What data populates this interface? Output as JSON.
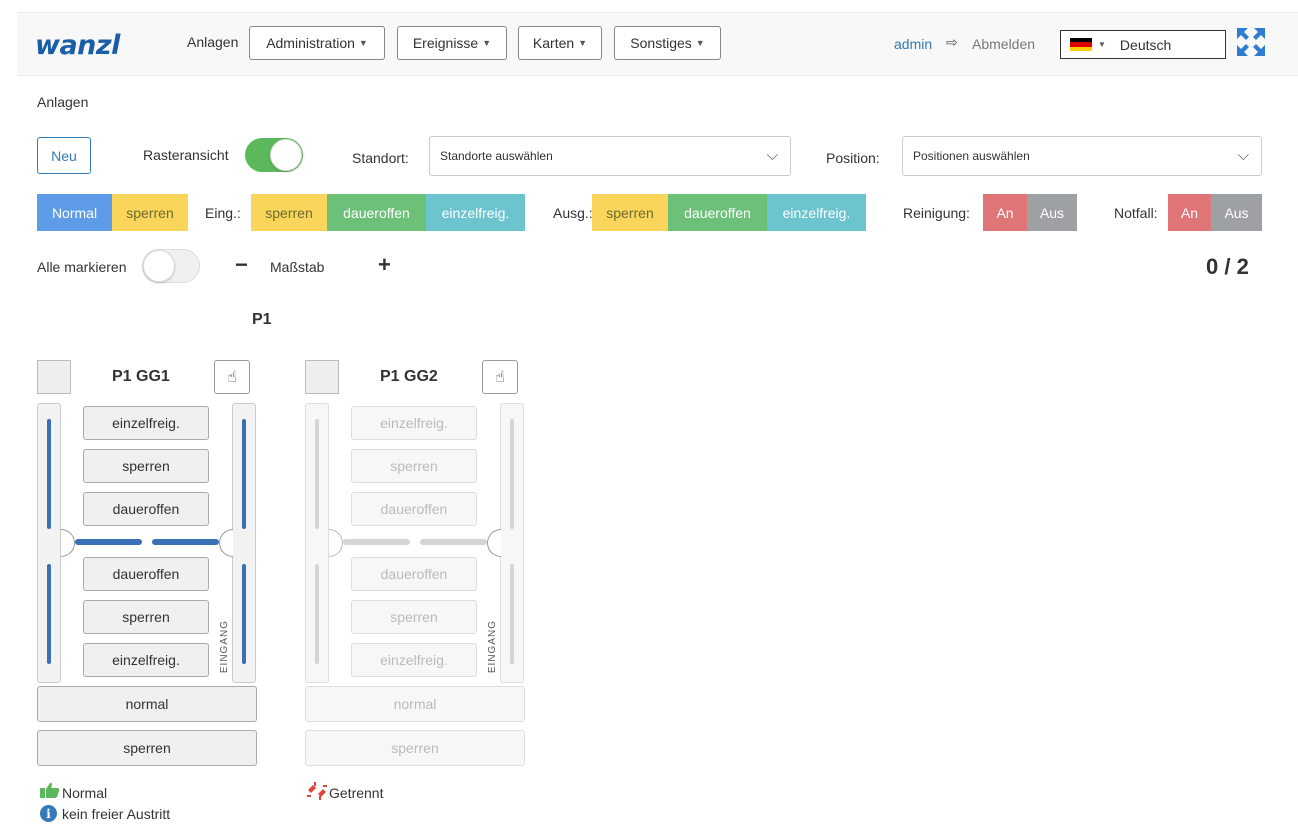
{
  "navbar": {
    "logo": "wanzl",
    "anlagen": "Anlagen",
    "menus": [
      "Administration",
      "Ereignisse",
      "Karten",
      "Sonstiges"
    ],
    "user": "admin",
    "logout": "Abmelden",
    "language": "Deutsch"
  },
  "breadcrumb": "Anlagen",
  "toolbar": {
    "new_label": "Neu",
    "grid_view_label": "Rasteransicht",
    "grid_view_on": true,
    "location_label": "Standort:",
    "location_placeholder": "Standorte auswählen",
    "position_label": "Position:",
    "position_placeholder": "Positionen auswählen"
  },
  "mode_bar": {
    "normal": "Normal",
    "lock": "sperren",
    "entry_label": "Eing.:",
    "entry": [
      "sperren",
      "daueroffen",
      "einzelfreig."
    ],
    "exit_label": "Ausg.:",
    "exit": [
      "sperren",
      "daueroffen",
      "einzelfreig."
    ],
    "cleaning_label": "Reinigung:",
    "emergency_label": "Notfall:",
    "on": "An",
    "off": "Aus"
  },
  "selection": {
    "select_all_label": "Alle markieren",
    "scale_label": "Maßstab",
    "minus": "−",
    "plus": "+",
    "count": "0 / 2"
  },
  "group_title": "P1",
  "gates": [
    {
      "name": "P1 GG1",
      "buttons_top": [
        "einzelfreig.",
        "sperren",
        "daueroffen"
      ],
      "buttons_bottom": [
        "daueroffen",
        "sperren",
        "einzelfreig."
      ],
      "entry_side": "EINGANG",
      "mode_normal": "normal",
      "mode_lock": "sperren",
      "status": [
        "Normal",
        "kein freier Austritt"
      ]
    },
    {
      "name": "P1 GG2",
      "buttons_top": [
        "einzelfreig.",
        "sperren",
        "daueroffen"
      ],
      "buttons_bottom": [
        "daueroffen",
        "sperren",
        "einzelfreig."
      ],
      "entry_side": "EINGANG",
      "mode_normal": "normal",
      "mode_lock": "sperren",
      "status": [
        "Getrennt"
      ]
    }
  ],
  "colors": {
    "brand": "#1a5fa6",
    "active_bar": "#3a6fb5",
    "inactive_bar": "#d5d5d5",
    "normal": "#5e9be8",
    "lock": "#f9d65b",
    "open": "#6cc078",
    "single": "#6cc4cf",
    "on": "#e07577",
    "off": "#9ea1a4"
  }
}
